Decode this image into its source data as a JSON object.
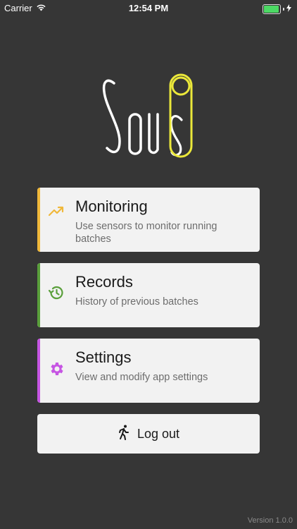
{
  "status_bar": {
    "carrier": "Carrier",
    "time": "12:54 PM",
    "battery_level": 0.95,
    "battery_color": "#4cd964"
  },
  "logo": {
    "text": "Sous",
    "accent_color": "#ebe83a"
  },
  "menu": [
    {
      "id": "monitoring",
      "title": "Monitoring",
      "description": "Use sensors to monitor running batches",
      "icon": "trending-up-icon",
      "accent": "#f0b83a"
    },
    {
      "id": "records",
      "title": "Records",
      "description": "History of previous batches",
      "icon": "history-icon",
      "accent": "#5a9f3b"
    },
    {
      "id": "settings",
      "title": "Settings",
      "description": "View and modify app settings",
      "icon": "gear-icon",
      "accent": "#c655e3"
    }
  ],
  "logout": {
    "label": "Log out",
    "icon": "walking-person-icon"
  },
  "version": "Version 1.0.0"
}
